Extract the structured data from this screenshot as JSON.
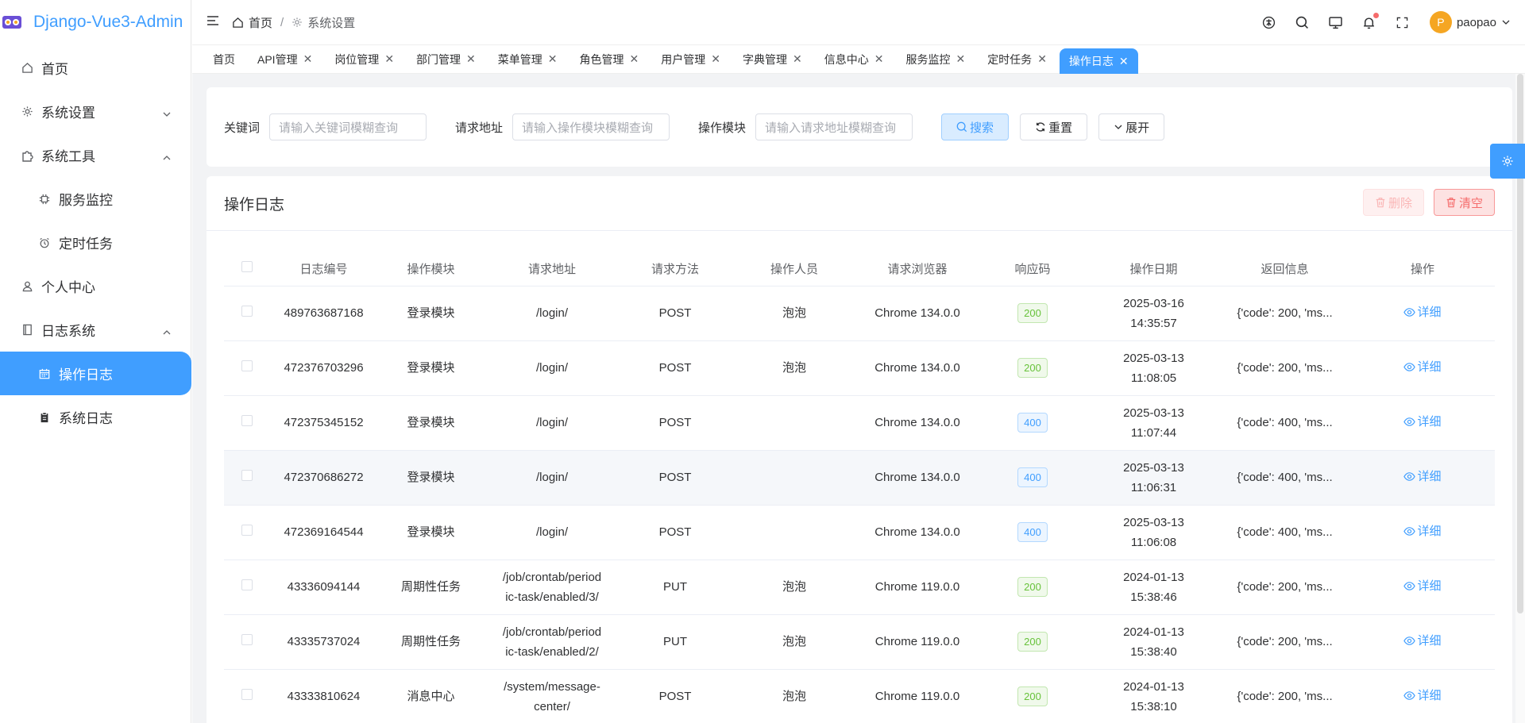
{
  "app": {
    "title": "Django-Vue3-Admin"
  },
  "sidebar": {
    "items": [
      {
        "label": "首页",
        "icon": "home-icon"
      },
      {
        "label": "系统设置",
        "icon": "gear-icon",
        "expanded": false
      },
      {
        "label": "系统工具",
        "icon": "puzzle-icon",
        "expanded": true
      },
      {
        "label": "服务监控",
        "icon": "cpu-icon",
        "sub": true
      },
      {
        "label": "定时任务",
        "icon": "alarm-clock-icon",
        "sub": true
      },
      {
        "label": "个人中心",
        "icon": "user-icon"
      },
      {
        "label": "日志系统",
        "icon": "notebook-icon",
        "expanded": true
      },
      {
        "label": "操作日志",
        "icon": "calendar-icon",
        "sub": true,
        "active": true
      },
      {
        "label": "系统日志",
        "icon": "clipboard-icon",
        "sub": true
      }
    ]
  },
  "header": {
    "breadcrumb": [
      "首页",
      "系统设置"
    ],
    "username": "paopao",
    "avatar_letter": "P"
  },
  "tabs": [
    {
      "label": "首页",
      "closable": false
    },
    {
      "label": "API管理",
      "closable": true
    },
    {
      "label": "岗位管理",
      "closable": true
    },
    {
      "label": "部门管理",
      "closable": true
    },
    {
      "label": "菜单管理",
      "closable": true
    },
    {
      "label": "角色管理",
      "closable": true
    },
    {
      "label": "用户管理",
      "closable": true
    },
    {
      "label": "字典管理",
      "closable": true
    },
    {
      "label": "信息中心",
      "closable": true
    },
    {
      "label": "服务监控",
      "closable": true
    },
    {
      "label": "定时任务",
      "closable": true
    },
    {
      "label": "操作日志",
      "closable": true,
      "active": true
    }
  ],
  "search": {
    "keyword_label": "关键词",
    "keyword_placeholder": "请输入关键词模糊查询",
    "url_label": "请求地址",
    "url_placeholder": "请输入操作模块模糊查询",
    "module_label": "操作模块",
    "module_placeholder": "请输入请求地址模糊查询",
    "search_btn": "搜索",
    "reset_btn": "重置",
    "expand_btn": "展开"
  },
  "card": {
    "title": "操作日志",
    "delete_btn": "删除",
    "clear_btn": "清空"
  },
  "table": {
    "columns": [
      "日志编号",
      "操作模块",
      "请求地址",
      "请求方法",
      "操作人员",
      "请求浏览器",
      "响应码",
      "操作日期",
      "返回信息",
      "操作"
    ],
    "detail_label": "详细",
    "rows": [
      {
        "id": "489763687168",
        "module": "登录模块",
        "url": "/login/",
        "method": "POST",
        "user": "泡泡",
        "browser": "Chrome 134.0.0",
        "code": "200",
        "date": "2025-03-16",
        "time": "14:35:57",
        "msg": "{'code': 200, 'ms..."
      },
      {
        "id": "472376703296",
        "module": "登录模块",
        "url": "/login/",
        "method": "POST",
        "user": "泡泡",
        "browser": "Chrome 134.0.0",
        "code": "200",
        "date": "2025-03-13",
        "time": "11:08:05",
        "msg": "{'code': 200, 'ms..."
      },
      {
        "id": "472375345152",
        "module": "登录模块",
        "url": "/login/",
        "method": "POST",
        "user": "",
        "browser": "Chrome 134.0.0",
        "code": "400",
        "date": "2025-03-13",
        "time": "11:07:44",
        "msg": "{'code': 400, 'ms..."
      },
      {
        "id": "472370686272",
        "module": "登录模块",
        "url": "/login/",
        "method": "POST",
        "user": "",
        "browser": "Chrome 134.0.0",
        "code": "400",
        "date": "2025-03-13",
        "time": "11:06:31",
        "msg": "{'code': 400, 'ms..."
      },
      {
        "id": "472369164544",
        "module": "登录模块",
        "url": "/login/",
        "method": "POST",
        "user": "",
        "browser": "Chrome 134.0.0",
        "code": "400",
        "date": "2025-03-13",
        "time": "11:06:08",
        "msg": "{'code': 400, 'ms..."
      },
      {
        "id": "43336094144",
        "module": "周期性任务",
        "url": "/job/crontab/period",
        "url2": "ic-task/enabled/3/",
        "method": "PUT",
        "user": "泡泡",
        "browser": "Chrome 119.0.0",
        "code": "200",
        "date": "2024-01-13",
        "time": "15:38:46",
        "msg": "{'code': 200, 'ms..."
      },
      {
        "id": "43335737024",
        "module": "周期性任务",
        "url": "/job/crontab/period",
        "url2": "ic-task/enabled/2/",
        "method": "PUT",
        "user": "泡泡",
        "browser": "Chrome 119.0.0",
        "code": "200",
        "date": "2024-01-13",
        "time": "15:38:40",
        "msg": "{'code': 200, 'ms..."
      },
      {
        "id": "43333810624",
        "module": "消息中心",
        "url": "/system/message-",
        "url2": "center/",
        "method": "POST",
        "user": "泡泡",
        "browser": "Chrome 119.0.0",
        "code": "200",
        "date": "2024-01-13",
        "time": "15:38:10",
        "msg": "{'code': 200, 'ms..."
      }
    ]
  },
  "colors": {
    "primary": "#409eff",
    "success": "#67c23a",
    "danger": "#f56c6c"
  }
}
